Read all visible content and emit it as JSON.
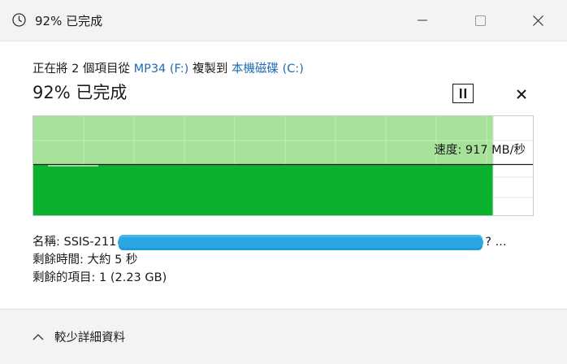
{
  "window": {
    "title": "92% 已完成",
    "icons": {
      "app": "clock-icon",
      "minimize": "minimize-icon",
      "maximize": "maximize-icon",
      "close": "close-icon"
    }
  },
  "copy": {
    "prefix": "正在將 2 個項目從 ",
    "source": "MP34 (F:)",
    "middle": " 複製到 ",
    "destination": "本機磁碟 (C:)",
    "progress_title": "92% 已完成",
    "progress": 0.92,
    "pause_icon": "pause-icon",
    "cancel_icon": "close-icon"
  },
  "speed": {
    "label": "速度: 917 MB/秒"
  },
  "details": {
    "name_label": "名稱:",
    "name_prefix": "SSIS-211",
    "name_suffix": "? ...",
    "time_remaining": "剩餘時間: 大約 5 秒",
    "items_remaining": "剩餘的項目: 1 (2.23 GB)"
  },
  "footer": {
    "toggle_label": "較少詳細資料",
    "toggle_icon": "chevron-up-icon"
  },
  "colors": {
    "graph_fill_light": "#a6e29a",
    "graph_fill_dark": "#0bb22d",
    "link": "#1f6bb5",
    "redaction": "#2aa7e3"
  }
}
